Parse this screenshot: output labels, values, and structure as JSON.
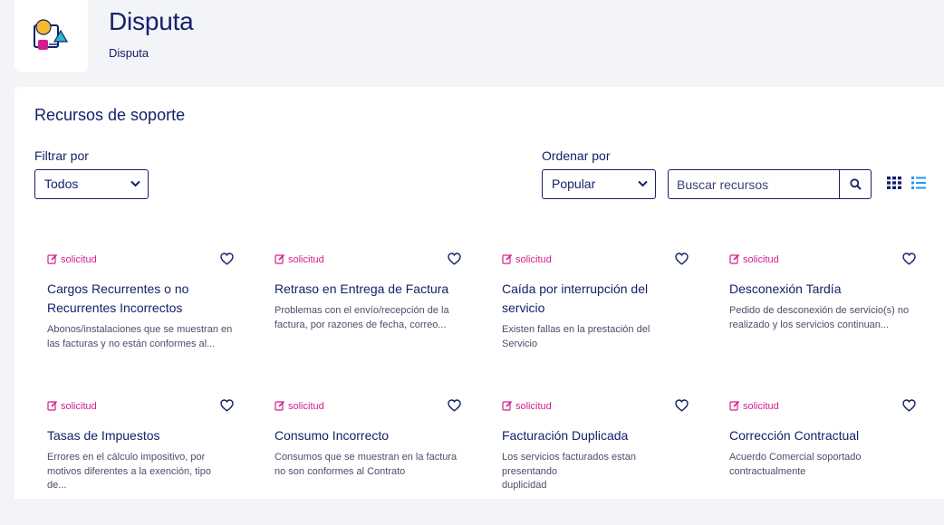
{
  "header": {
    "title": "Disputa",
    "breadcrumb": "Disputa",
    "logo_icon": "dispute-illustration-icon"
  },
  "panel": {
    "section_title": "Recursos de soporte",
    "filter": {
      "label": "Filtrar por",
      "value": "Todos"
    },
    "sort": {
      "label": "Ordenar por",
      "value": "Popular"
    },
    "search": {
      "placeholder": "Buscar recursos"
    },
    "views": [
      "grid-view-icon",
      "list-view-icon"
    ]
  },
  "colors": {
    "primary": "#14216b",
    "accent": "#d31f8d",
    "active_view": "#1d9bf0"
  },
  "cards": [
    {
      "tag": "solicitud",
      "title_lines": [
        "Cargos Recurrentes o no",
        "Recurrentes Incorrectos"
      ],
      "desc_lines": [
        "Abonos/instalaciones que se muestran en",
        "las facturas y no están conformes al..."
      ]
    },
    {
      "tag": "solicitud",
      "title_lines": [
        "Retraso en Entrega de Factura"
      ],
      "desc_lines": [
        "Problemas con el envío/recepción de la",
        "factura, por razones de fecha, correo..."
      ]
    },
    {
      "tag": "solicitud",
      "title_lines": [
        "Caída por interrupción del",
        "servicio"
      ],
      "desc_lines": [
        "Existen fallas en la prestación del Servicio"
      ]
    },
    {
      "tag": "solicitud",
      "title_lines": [
        "Desconexión Tardía"
      ],
      "desc_lines": [
        "Pedido de desconexión de servicio(s) no",
        "realizado y los servicios continuan..."
      ]
    },
    {
      "tag": "solicitud",
      "title_lines": [
        "Tasas de Impuestos"
      ],
      "desc_lines": [
        "Errores en el cálculo impositivo, por",
        "motivos diferentes a la exención, tipo de..."
      ]
    },
    {
      "tag": "solicitud",
      "title_lines": [
        "Consumo Incorrecto"
      ],
      "desc_lines": [
        "Consumos que se muestran en la factura",
        "no son conformes al Contrato"
      ]
    },
    {
      "tag": "solicitud",
      "title_lines": [
        "Facturación Duplicada"
      ],
      "desc_lines": [
        "Los servicios facturados estan presentando",
        "duplicidad"
      ]
    },
    {
      "tag": "solicitud",
      "title_lines": [
        "Corrección Contractual"
      ],
      "desc_lines": [
        "Acuerdo Comercial soportado",
        "contractualmente"
      ]
    }
  ]
}
